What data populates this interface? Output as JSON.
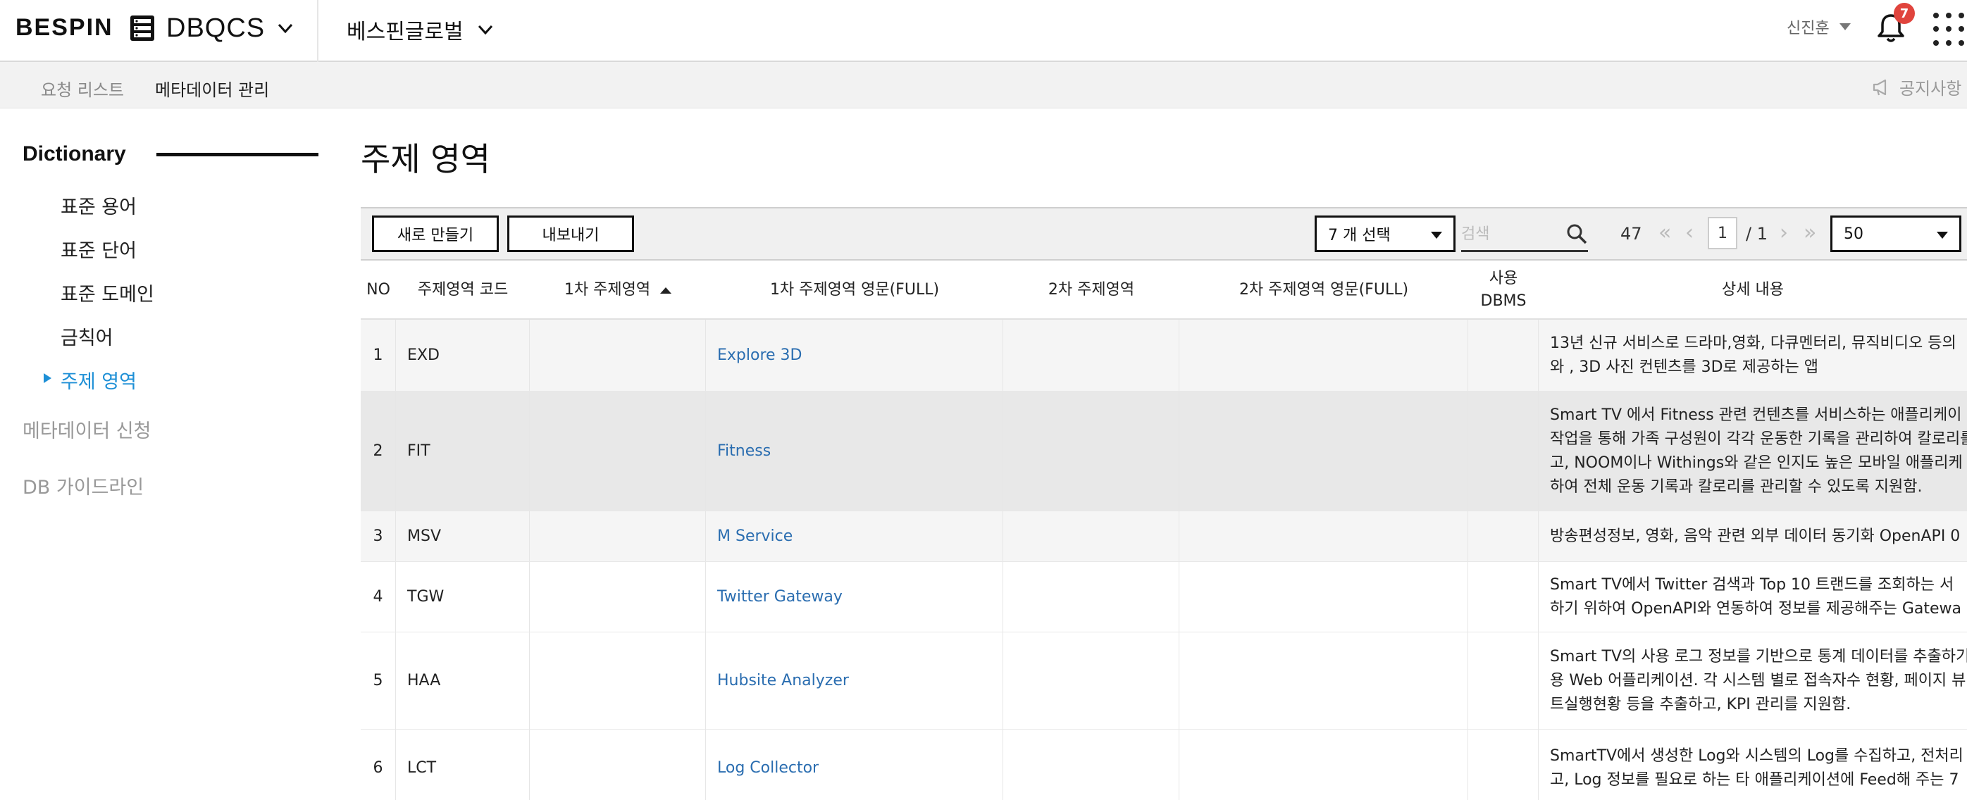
{
  "header": {
    "logo": "BESPIN",
    "app_name": "DBQCS",
    "org_name": "베스핀글로벌",
    "user_name": "신진훈",
    "notification_count": "7"
  },
  "subnav": {
    "items": [
      {
        "label": "요청 리스트"
      },
      {
        "label": "메타데이터 관리"
      }
    ],
    "notice_label": "공지사항"
  },
  "sidebar": {
    "section_title": "Dictionary",
    "sub_items": [
      {
        "label": "표준 용어"
      },
      {
        "label": "표준 단어"
      },
      {
        "label": "표준 도메인"
      },
      {
        "label": "금칙어"
      },
      {
        "label": "주제 영역"
      }
    ],
    "active_sub_item": "주제 영역",
    "main_items": [
      {
        "label": "메타데이터 신청"
      },
      {
        "label": "DB 가이드라인"
      }
    ]
  },
  "main": {
    "page_title": "주제 영역",
    "toolbar": {
      "new_label": "새로 만들기",
      "export_label": "내보내기",
      "column_select_value": "7 개 선택",
      "search_placeholder": "검색",
      "total_count": "47",
      "current_page": "1",
      "total_pages": "/ 1",
      "page_size_value": "50"
    },
    "table": {
      "columns": [
        {
          "label": "NO"
        },
        {
          "label": "주제영역 코드"
        },
        {
          "label": "1차 주제영역"
        },
        {
          "label": "1차 주제영역 영문(FULL)"
        },
        {
          "label": "2차 주제영역"
        },
        {
          "label": "2차 주제영역 영문(FULL)"
        },
        {
          "label": "사용\nDBMS"
        },
        {
          "label": "상세 내용"
        }
      ],
      "sorted_column": "1차 주제영역",
      "rows": [
        {
          "no": "1",
          "code": "EXD",
          "primary": "",
          "primary_en": "Explore 3D",
          "secondary": "",
          "secondary_en": "",
          "dbms": "",
          "detail": "13년 신규 서비스로 드라마,영화, 다큐멘터리, 뮤직비디오 등의\n와 , 3D 사진 컨텐츠를 3D로 제공하는 앱"
        },
        {
          "no": "2",
          "code": "FIT",
          "primary": "",
          "primary_en": "Fitness",
          "secondary": "",
          "secondary_en": "",
          "dbms": "",
          "detail": "Smart TV 에서 Fitness 관련 컨텐츠를 서비스하는 애플리케이\n작업을 통해 가족 구성원이 각각 운동한 기록을 관리하여 칼로리를\n고, NOOM이나 Withings와 같은 인지도 높은 모바일 애플리케\n하여 전체 운동 기록과 칼로리를 관리할 수 있도록 지원함."
        },
        {
          "no": "3",
          "code": "MSV",
          "primary": "",
          "primary_en": "M Service",
          "secondary": "",
          "secondary_en": "",
          "dbms": "",
          "detail": "방송편성정보, 영화, 음악 관련 외부 데이터 동기화 OpenAPI 0"
        },
        {
          "no": "4",
          "code": "TGW",
          "primary": "",
          "primary_en": "Twitter Gateway",
          "secondary": "",
          "secondary_en": "",
          "dbms": "",
          "detail": "Smart TV에서 Twitter 검색과 Top 10 트랜드를 조회하는 서\n하기 위하여 OpenAPI와 연동하여 정보를 제공해주는 Gatewa"
        },
        {
          "no": "5",
          "code": "HAA",
          "primary": "",
          "primary_en": "Hubsite Analyzer",
          "secondary": "",
          "secondary_en": "",
          "dbms": "",
          "detail": "Smart TV의 사용 로그 정보를 기반으로 통계 데이터를 추출하기\n용 Web 어플리케이션. 각 시스템 별로 접속자수 현황, 페이지 뷰\n트실행현황 등을 추출하고, KPI 관리를 지원함."
        },
        {
          "no": "6",
          "code": "LCT",
          "primary": "",
          "primary_en": "Log Collector",
          "secondary": "",
          "secondary_en": "",
          "dbms": "",
          "detail": "SmartTV에서 생성한 Log와 시스템의 Log를 수집하고, 전처리\n고, Log 정보를 필요로 하는 타 애플리케이션에 Feed해 주는 7"
        }
      ]
    }
  },
  "colors": {
    "accent_blue": "#1d8fd6",
    "link_blue": "#2a6db0",
    "badge_red": "#e0443d",
    "row_alt": "#f5f5f5",
    "row_selected": "#e8e8e8"
  }
}
